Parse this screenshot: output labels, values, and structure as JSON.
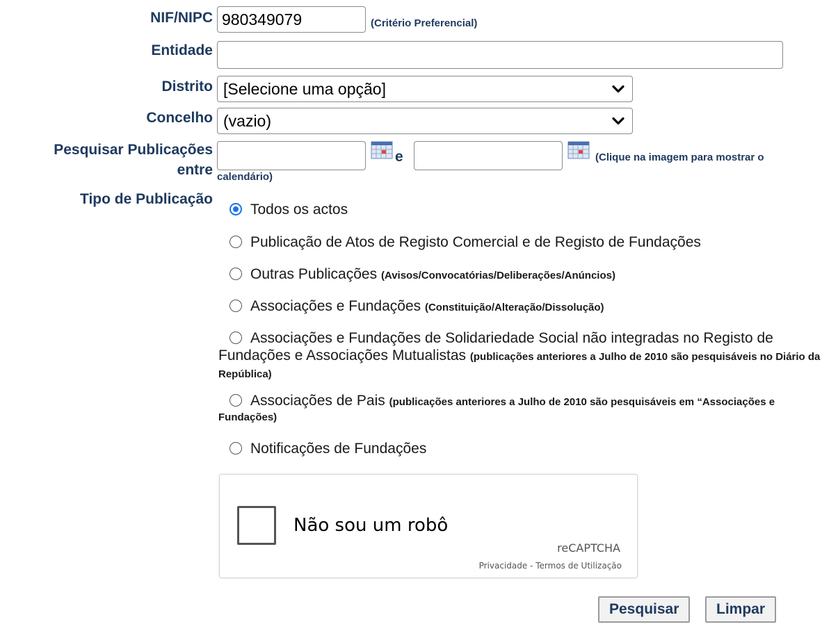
{
  "form": {
    "nif_label": "NIF/NIPC",
    "nif_value": "980349079",
    "nif_hint": "(Critério Preferencial)",
    "entidade_label": "Entidade",
    "entidade_value": "",
    "distrito_label": "Distrito",
    "distrito_selected": "[Selecione uma opção]",
    "concelho_label": "Concelho",
    "concelho_selected": "(vazio)",
    "pesquisar_label_1": "Pesquisar Publicações",
    "pesquisar_label_2": "entre",
    "date_from": "",
    "date_to": "",
    "date_sep": "e",
    "calendar_hint_1": "(Clique na imagem para mostrar o",
    "calendar_hint_2": "calendário)",
    "tipo_label": "Tipo de Publicação",
    "tipo_options": [
      {
        "label": "Todos os actos",
        "note": "",
        "checked": true
      },
      {
        "label": "Publicação de Atos de Registo Comercial e de Registo de Fundações",
        "note": "",
        "checked": false
      },
      {
        "label": "Outras Publicações",
        "note": "(Avisos/Convocatórias/Deliberações/Anúncios)",
        "checked": false
      },
      {
        "label": "Associações e Fundações",
        "note": "(Constituição/Alteração/Dissolução)",
        "checked": false
      },
      {
        "label": "Associações e Fundações de Solidariedade Social não integradas no Registo de Fundações e Associações Mutualistas",
        "note": "(publicações anteriores a Julho de 2010 são pesquisáveis no Diário da República)",
        "checked": false
      },
      {
        "label": "Associações de Pais",
        "note": "(publicações anteriores a Julho de 2010 são pesquisáveis em “Associações e Fundações)",
        "checked": false
      },
      {
        "label": "Notificações de Fundações",
        "note": "",
        "checked": false
      }
    ]
  },
  "recaptcha": {
    "label": "Não sou um robô",
    "brand": "reCAPTCHA",
    "privacy": "Privacidade",
    "separator": " - ",
    "terms": "Termos de Utilização"
  },
  "buttons": {
    "search": "Pesquisar",
    "clear": "Limpar"
  },
  "colors": {
    "label": "#1e3a5f",
    "radio_checked": "#1a73e8"
  },
  "icons": {
    "calendar": "calendar-icon",
    "select": "chevron-down-icon"
  }
}
